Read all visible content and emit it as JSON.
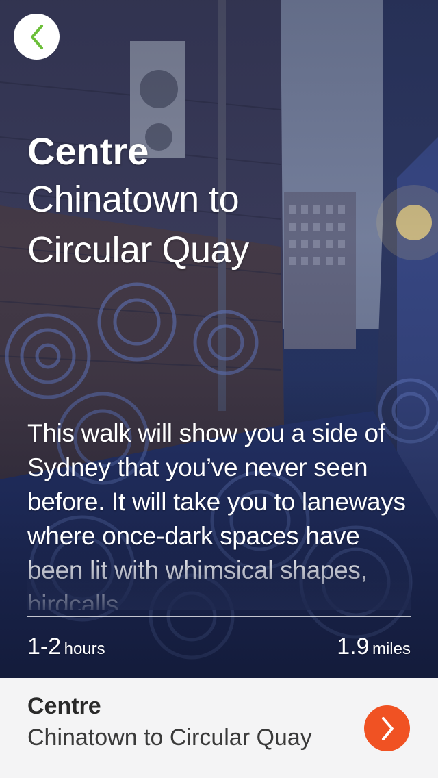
{
  "colors": {
    "accent_green": "#6cbf3a",
    "accent_orange": "#f05223",
    "card_background": "#f4f4f5",
    "text_white": "#ffffff",
    "text_dark": "#2b2b2b"
  },
  "header": {
    "back_icon": "chevron-left-icon"
  },
  "walk": {
    "region": "Centre",
    "route_line1": "Chinatown to",
    "route_line2": "Circular Quay",
    "description": "This walk will show you a side of Sydney that you’ve never seen before. It will take you to laneways where once-dark spaces have been lit with whimsical shapes, birdcalls",
    "duration_value": "1-2",
    "duration_unit": "hours",
    "distance_value": "1.9",
    "distance_unit": "miles"
  },
  "card": {
    "region": "Centre",
    "route": "Chinatown to Circular Quay",
    "next_icon": "chevron-right-icon"
  }
}
